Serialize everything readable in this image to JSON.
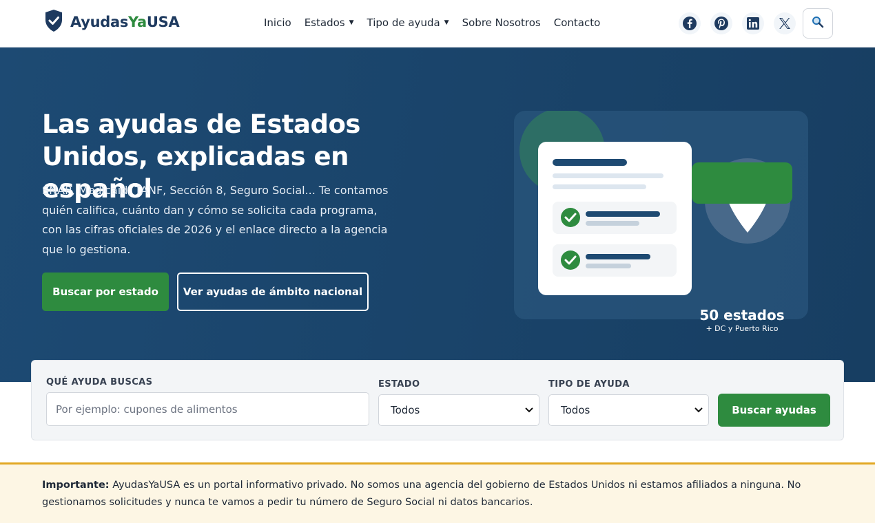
{
  "brand": {
    "name_part1": "Ayudas",
    "name_part2": "Ya",
    "name_part3": "USA",
    "logo_icon": "shield-check-icon"
  },
  "nav": {
    "items": [
      {
        "label": "Inicio",
        "has_dropdown": false
      },
      {
        "label": "Estados",
        "has_dropdown": true
      },
      {
        "label": "Tipo de ayuda",
        "has_dropdown": true
      },
      {
        "label": "Sobre Nosotros",
        "has_dropdown": false
      },
      {
        "label": "Contacto",
        "has_dropdown": false
      }
    ],
    "caret": "▼"
  },
  "socials": [
    "facebook-icon",
    "pinterest-icon",
    "linkedin-icon",
    "x-icon"
  ],
  "hero": {
    "title": "Las ayudas de Estados Unidos, explicadas en español",
    "description": "SNAP, Medicaid, TANF, Sección 8, Seguro Social... Te contamos quién califica, cuánto dan y cómo se solicita cada programa, con las cifras oficiales de 2026 y el enlace directo a la agencia que lo gestiona.",
    "primary_button": "Buscar por estado",
    "secondary_button": "Ver ayudas de ámbito nacional",
    "badge_title": "50 estados",
    "badge_subtitle": "+ DC y Puerto Rico"
  },
  "search": {
    "query_label": "QUÉ AYUDA BUSCAS",
    "query_placeholder": "Por ejemplo: cupones de alimentos",
    "state_label": "ESTADO",
    "state_value": "Todos",
    "type_label": "TIPO DE AYUDA",
    "type_value": "Todos",
    "submit": "Buscar ayudas"
  },
  "notice": {
    "bold": "Importante:",
    "text": " AyudasYaUSA es un portal informativo privado. No somos una agencia del gobierno de Estados Unidos ni estamos afiliados a ninguna. No gestionamos solicitudes y nunca te vamos a pedir tu número de Seguro Social ni datos bancarios."
  },
  "colors": {
    "brand_navy": "#1e3a5f",
    "brand_green": "#2e8b3f",
    "hero_bg": "#1d4a73",
    "notice_bg": "#fdf6e4",
    "notice_border": "#e2a722"
  }
}
